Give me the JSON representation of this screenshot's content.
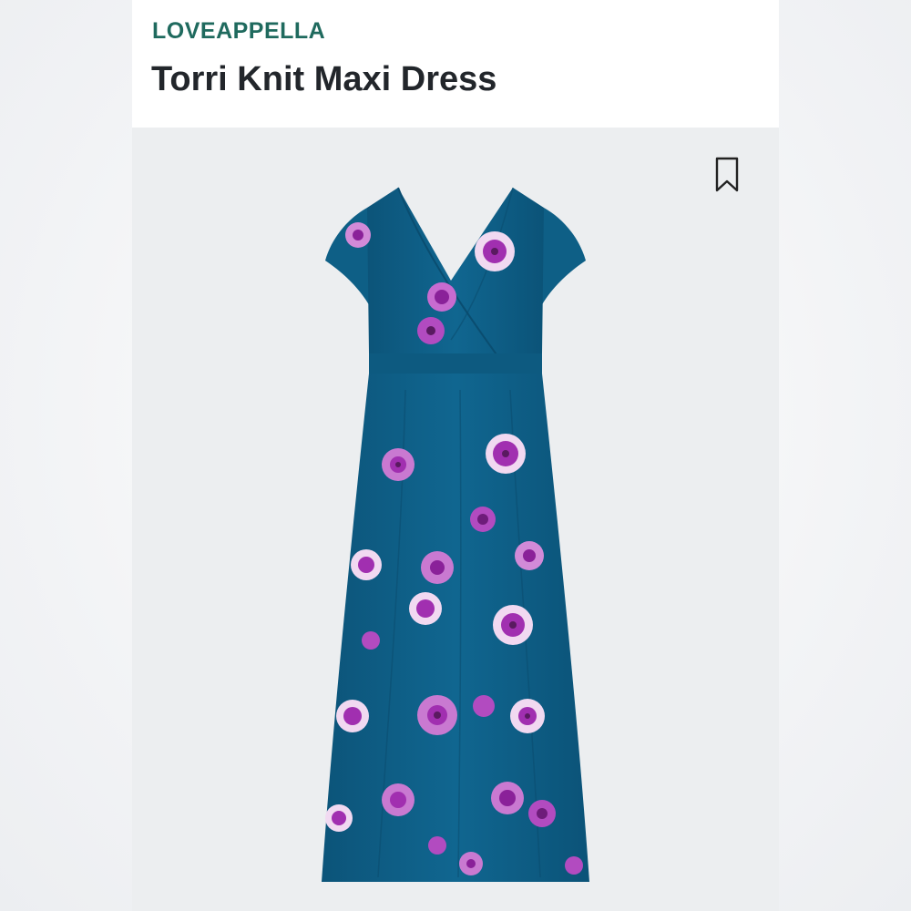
{
  "product": {
    "brand": "LOVEAPPELLA",
    "title": "Torri Knit Maxi Dress"
  },
  "icons": {
    "bookmark": "bookmark-icon"
  },
  "colors": {
    "brand": "#1f6a5e",
    "title": "#22262b",
    "dress": "#0f5f86",
    "flower": "#a12fb0",
    "flower_light": "#f1d9f1"
  }
}
